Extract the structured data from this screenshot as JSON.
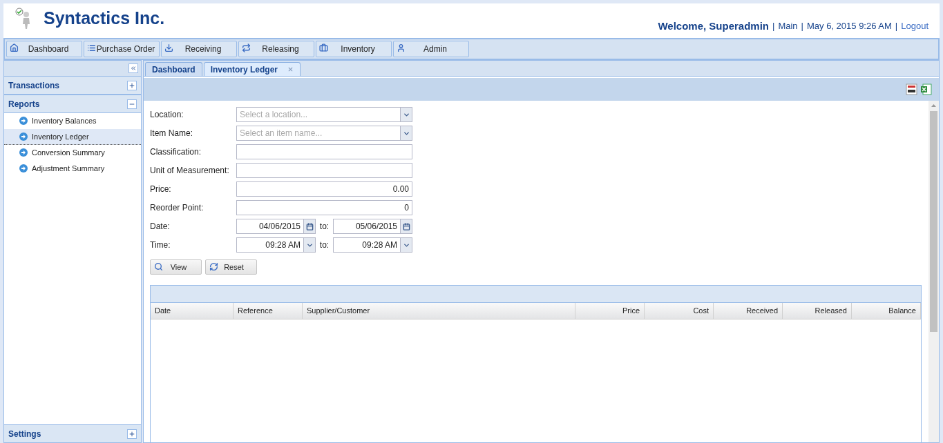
{
  "header": {
    "company": "Syntactics Inc.",
    "welcome": "Welcome, Superadmin",
    "links": [
      {
        "separator": "|",
        "text": "Main",
        "kind": "text"
      },
      {
        "separator": "|",
        "text": "May 6, 2015 9:26 AM",
        "kind": "text"
      },
      {
        "separator": "|",
        "text": "Logout",
        "kind": "link"
      }
    ]
  },
  "nav": [
    {
      "label": "Dashboard"
    },
    {
      "label": "Purchase Order"
    },
    {
      "label": "Receiving"
    },
    {
      "label": "Releasing"
    },
    {
      "label": "Inventory"
    },
    {
      "label": "Admin"
    }
  ],
  "sidebar": {
    "sections": [
      {
        "title": "Transactions",
        "expanded": false
      },
      {
        "title": "Reports",
        "expanded": true,
        "items": [
          {
            "label": "Inventory Balances",
            "selected": false
          },
          {
            "label": "Inventory Ledger",
            "selected": true
          },
          {
            "label": "Conversion Summary",
            "selected": false
          },
          {
            "label": "Adjustment Summary",
            "selected": false
          }
        ]
      }
    ],
    "footer": {
      "title": "Settings",
      "expanded": false
    }
  },
  "tabs": [
    {
      "label": "Dashboard",
      "selected": false,
      "closable": false
    },
    {
      "label": "Inventory Ledger",
      "selected": true,
      "closable": true
    }
  ],
  "form": [
    {
      "label": "Location:",
      "kind": "combo",
      "placeholder": "Select a location..."
    },
    {
      "label": "Item Name:",
      "kind": "combo",
      "placeholder": "Select an item name..."
    },
    {
      "label": "Classification:",
      "kind": "text"
    },
    {
      "label": "Unit of Measurement:",
      "kind": "text"
    },
    {
      "label": "Price:",
      "kind": "number",
      "value": "0.00"
    },
    {
      "label": "Reorder Point:",
      "kind": "number",
      "value": "0"
    },
    {
      "label": "Date:",
      "kind": "date-range",
      "from": "04/06/2015",
      "separator": "to:",
      "to": "05/06/2015"
    },
    {
      "label": "Time:",
      "kind": "time-range",
      "from": "09:28 AM",
      "separator": "to:",
      "to": "09:28 AM"
    }
  ],
  "buttons": [
    {
      "label": "View"
    },
    {
      "label": "Reset"
    }
  ],
  "table": {
    "columns": [
      "Date",
      "Reference",
      "Supplier/Customer",
      "Price",
      "Cost",
      "Received",
      "Released",
      "Balance"
    ]
  }
}
